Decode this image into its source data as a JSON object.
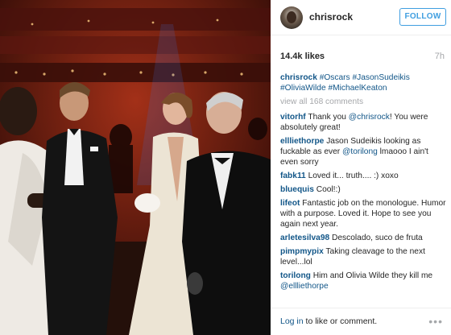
{
  "post": {
    "username": "chrisrock",
    "follow_label": "FOLLOW",
    "likes": "14.4k likes",
    "time": "7h",
    "caption": {
      "user": "chrisrock",
      "tags": [
        "#Oscars",
        "#JasonSudeikis",
        "#OliviaWilde",
        "#MichaelKeaton"
      ]
    },
    "view_all": "view all 168 comments",
    "comments": [
      {
        "user": "vitorhf",
        "parts": [
          {
            "t": "Thank you "
          },
          {
            "t": "@chrisrock",
            "tag": true
          },
          {
            "t": "! You were absolutely great!"
          }
        ]
      },
      {
        "user": "ellliethorpe",
        "parts": [
          {
            "t": "Jason Sudeikis looking as fuckable as ever "
          },
          {
            "t": "@torilong",
            "tag": true
          },
          {
            "t": " lmaooo I ain't even sorry"
          }
        ]
      },
      {
        "user": "fabk11",
        "parts": [
          {
            "t": "Loved it... truth.... :) xoxo"
          }
        ]
      },
      {
        "user": "bluequis",
        "parts": [
          {
            "t": "Cool!:)"
          }
        ]
      },
      {
        "user": "lifeot",
        "parts": [
          {
            "t": "Fantastic job on the monologue. Humor with a purpose. Loved it. Hope to see you again next year."
          }
        ]
      },
      {
        "user": "arletesilva98",
        "parts": [
          {
            "t": "Descolado, suco de fruta"
          }
        ]
      },
      {
        "user": "pimpmypix",
        "parts": [
          {
            "t": "Taking cleavage to the next level...lol"
          }
        ]
      },
      {
        "user": "torilong",
        "parts": [
          {
            "t": "Him and Olivia Wilde they kill me "
          },
          {
            "t": "@ellliethorpe",
            "tag": true
          }
        ]
      }
    ],
    "footer": {
      "login_link": "Log in",
      "login_rest": " to like or comment.",
      "more": "•••"
    }
  },
  "colors": {
    "link": "#125688",
    "follow": "#3f9ee0",
    "muted": "#a5a7aa"
  },
  "icons": [
    "avatar",
    "more-options-icon"
  ]
}
